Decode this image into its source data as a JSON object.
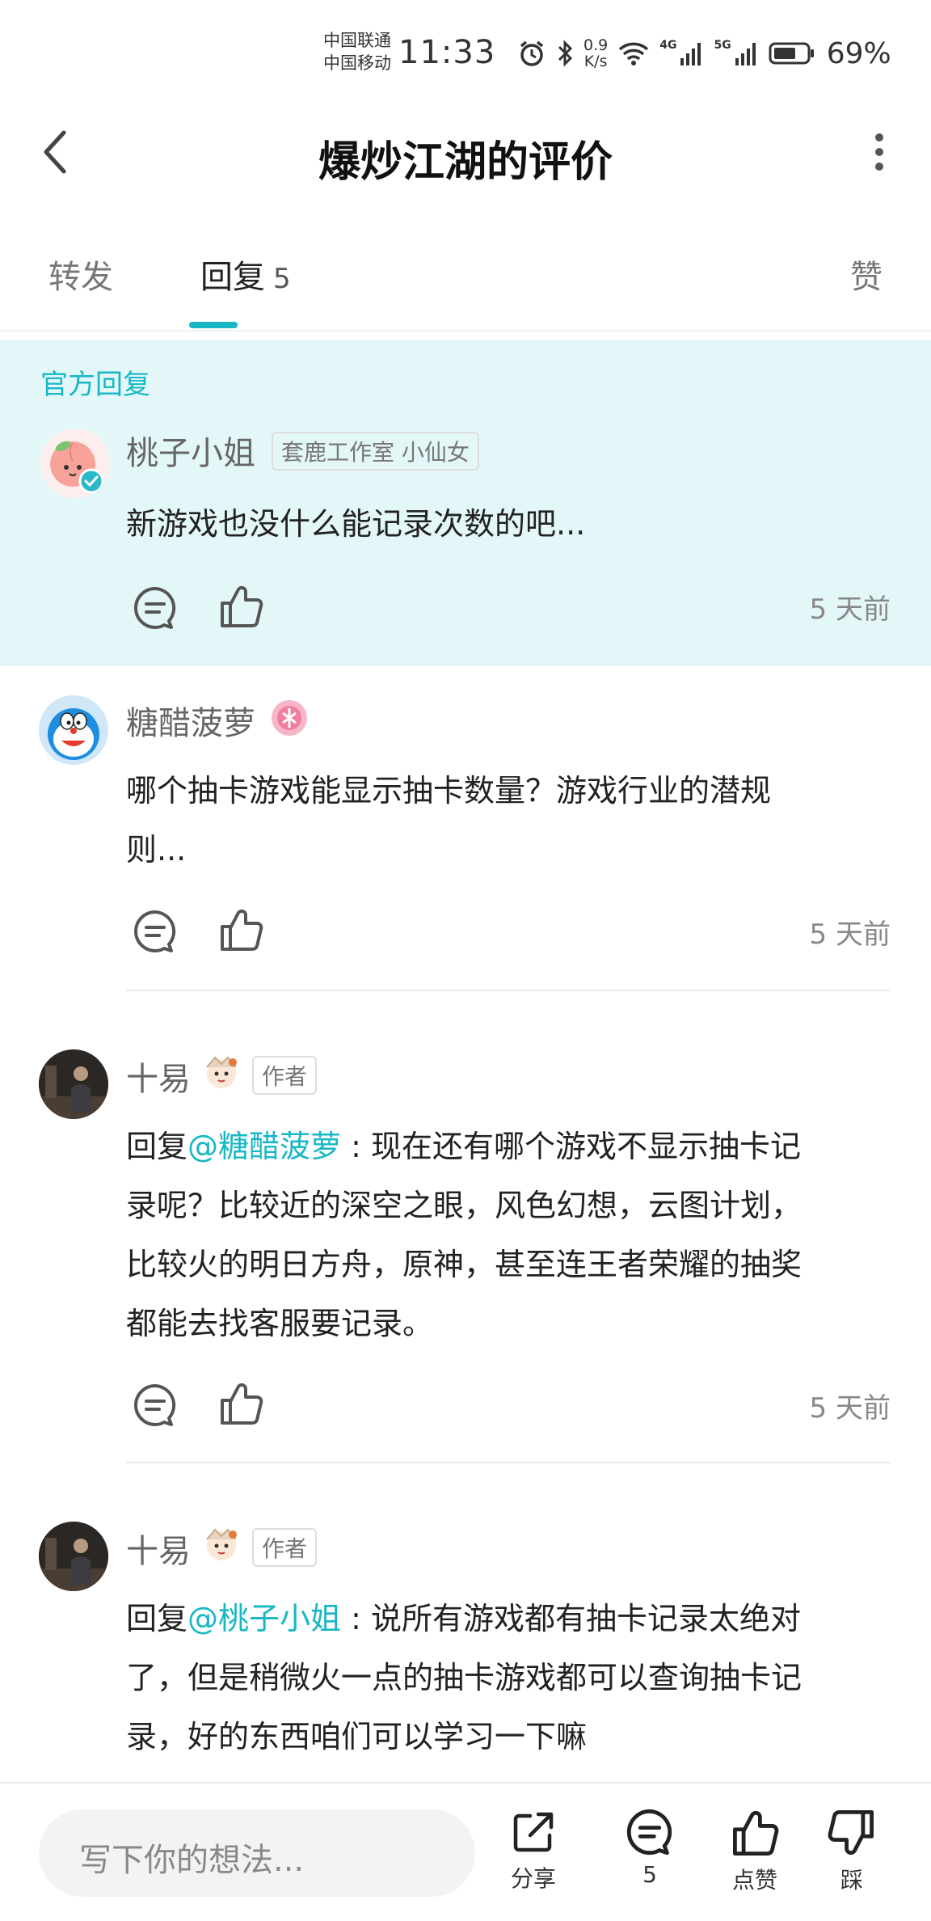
{
  "status_bar": {
    "carrier_1": "中国联通",
    "carrier_2": "中国移动",
    "time": "11:33",
    "net_speed_value": "0.9",
    "net_speed_unit": "K/s",
    "net_4g": "4G",
    "net_5g": "5G",
    "battery": "69%"
  },
  "header": {
    "title": "爆炒江湖的评价"
  },
  "tabs": {
    "forward": "转发",
    "reply": "回复",
    "reply_count": "5",
    "like": "赞"
  },
  "official": {
    "label": "官方回复",
    "user": "桃子小姐",
    "badge": "套鹿工作室 小仙女",
    "text": "新游戏也没什么能记录次数的吧...",
    "time": "5 天前"
  },
  "comments": [
    {
      "user": "糖醋菠萝",
      "line1": "哪个抽卡游戏能显示抽卡数量？游戏行业的潜规",
      "line2": "则...",
      "time": "5 天前"
    },
    {
      "user": "十易",
      "tag": "作者",
      "reply_prefix": "回复",
      "mention": "@糖醋菠萝",
      "line1_rest": " : 现在还有哪个游戏不显示抽卡记",
      "line2": "录呢？比较近的深空之眼，风色幻想，云图计划，",
      "line3": "比较火的明日方舟，原神，甚至连王者荣耀的抽奖",
      "line4": "都能去找客服要记录。",
      "time": "5 天前"
    },
    {
      "user": "十易",
      "tag": "作者",
      "reply_prefix": "回复",
      "mention": "@桃子小姐",
      "line1_rest": " : 说所有游戏都有抽卡记录太绝对",
      "line2": "了，但是稍微火一点的抽卡游戏都可以查询抽卡记",
      "line3": "录，好的东西咱们可以学习一下嘛"
    }
  ],
  "bottom_bar": {
    "input_placeholder": "写下你的想法...",
    "share": "分享",
    "comment_count": "5",
    "like": "点赞",
    "dislike": "踩"
  },
  "colors": {
    "accent": "#17b7c6",
    "official_bg": "#e4f7f8"
  }
}
